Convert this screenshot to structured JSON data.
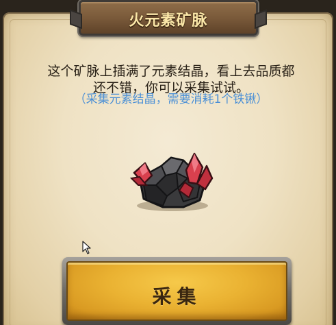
{
  "dialog": {
    "title": "火元素矿脉",
    "description_line1": "这个矿脉上插满了元素结晶，看上去品质都",
    "description_line2": "还不错，你可以采集试试。",
    "hint": "（采集元素结晶，需要消耗1个铁锹）",
    "illustration": "fire-crystal-ore-icon",
    "collect_label": "采集"
  },
  "colors": {
    "parchment": "#efe2c4",
    "title_text": "#fbe7a8",
    "hint_text": "#4a8fd6",
    "button_gold": "#eab232"
  }
}
